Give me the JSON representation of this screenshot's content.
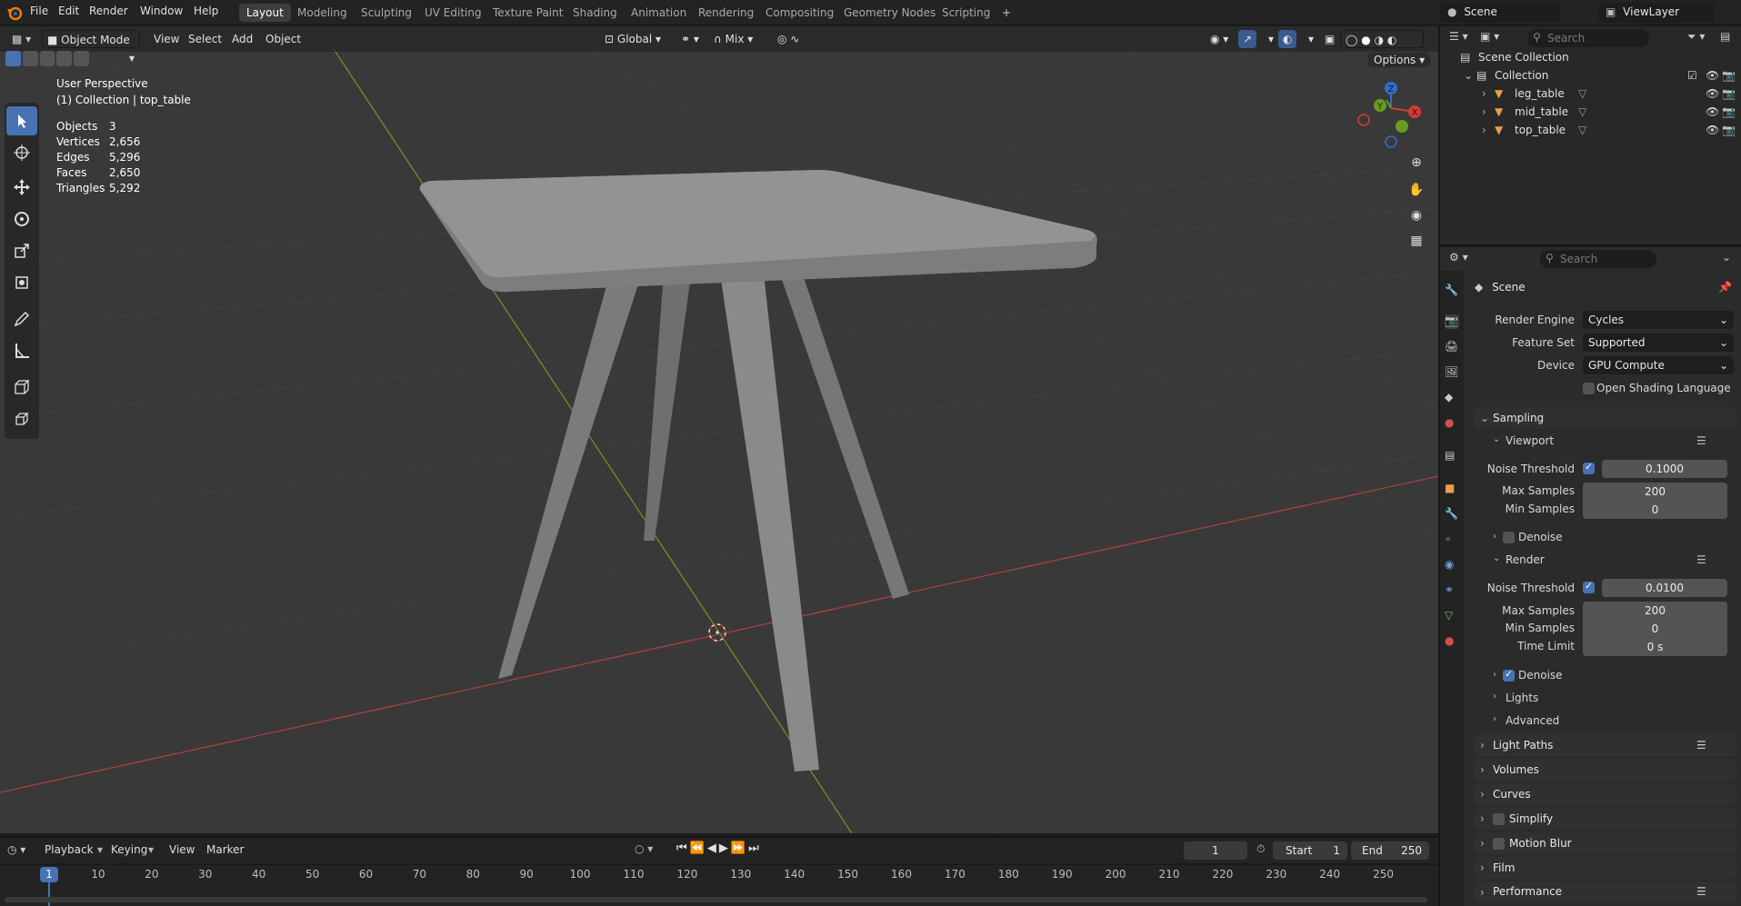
{
  "menu": {
    "file": "File",
    "edit": "Edit",
    "render": "Render",
    "window": "Window",
    "help": "Help"
  },
  "workspaces": [
    "Layout",
    "Modeling",
    "Sculpting",
    "UV Editing",
    "Texture Paint",
    "Shading",
    "Animation",
    "Rendering",
    "Compositing",
    "Geometry Nodes",
    "Scripting"
  ],
  "add_workspace": "+",
  "scene": {
    "label": "Scene",
    "viewlayer": "ViewLayer"
  },
  "viewport_header": {
    "mode": "Object Mode",
    "view": "View",
    "select": "Select",
    "add": "Add",
    "object": "Object",
    "orientation": "Global",
    "snap": "Mix",
    "options": "Options"
  },
  "overlay_text": {
    "perspective": "User Perspective",
    "collection": "(1) Collection | top_table"
  },
  "stats": [
    {
      "label": "Objects",
      "value": "3"
    },
    {
      "label": "Vertices",
      "value": "2,656"
    },
    {
      "label": "Edges",
      "value": "5,296"
    },
    {
      "label": "Faces",
      "value": "2,650"
    },
    {
      "label": "Triangles",
      "value": "5,292"
    }
  ],
  "outliner": {
    "search_placeholder": "Search",
    "scene_collection": "Scene Collection",
    "collection": "Collection",
    "items": [
      "leg_table",
      "mid_table",
      "top_table"
    ]
  },
  "properties": {
    "search_placeholder": "Search",
    "context": "Scene",
    "render_engine_label": "Render Engine",
    "render_engine": "Cycles",
    "feature_set_label": "Feature Set",
    "feature_set": "Supported",
    "device_label": "Device",
    "device": "GPU Compute",
    "osl": "Open Shading Language",
    "sampling": "Sampling",
    "viewport": {
      "title": "Viewport",
      "noise_threshold_label": "Noise Threshold",
      "noise_threshold": "0.1000",
      "max_samples_label": "Max Samples",
      "max_samples": "200",
      "min_samples_label": "Min Samples",
      "min_samples": "0",
      "denoise": "Denoise"
    },
    "render": {
      "title": "Render",
      "noise_threshold_label": "Noise Threshold",
      "noise_threshold": "0.0100",
      "max_samples_label": "Max Samples",
      "max_samples": "200",
      "min_samples_label": "Min Samples",
      "min_samples": "0",
      "time_limit_label": "Time Limit",
      "time_limit": "0 s",
      "denoise": "Denoise"
    },
    "lights": "Lights",
    "advanced": "Advanced",
    "sections": [
      "Light Paths",
      "Volumes",
      "Curves",
      "Simplify",
      "Motion Blur",
      "Film",
      "Performance"
    ]
  },
  "timeline": {
    "playback": "Playback",
    "keying": "Keying",
    "view": "View",
    "marker": "Marker",
    "current_frame": "1",
    "start_label": "Start",
    "start": "1",
    "end_label": "End",
    "end": "250",
    "ticks": [
      "10",
      "20",
      "30",
      "40",
      "50",
      "60",
      "70",
      "80",
      "90",
      "100",
      "110",
      "120",
      "130",
      "140",
      "150",
      "160",
      "170",
      "180",
      "190",
      "200",
      "210",
      "220",
      "230",
      "240",
      "250"
    ],
    "playhead": "1"
  },
  "colors": {
    "accent": "#4772b3",
    "x_axis": "#b04040",
    "y_axis": "#7a9a30",
    "mesh": "#8f8f8f"
  }
}
